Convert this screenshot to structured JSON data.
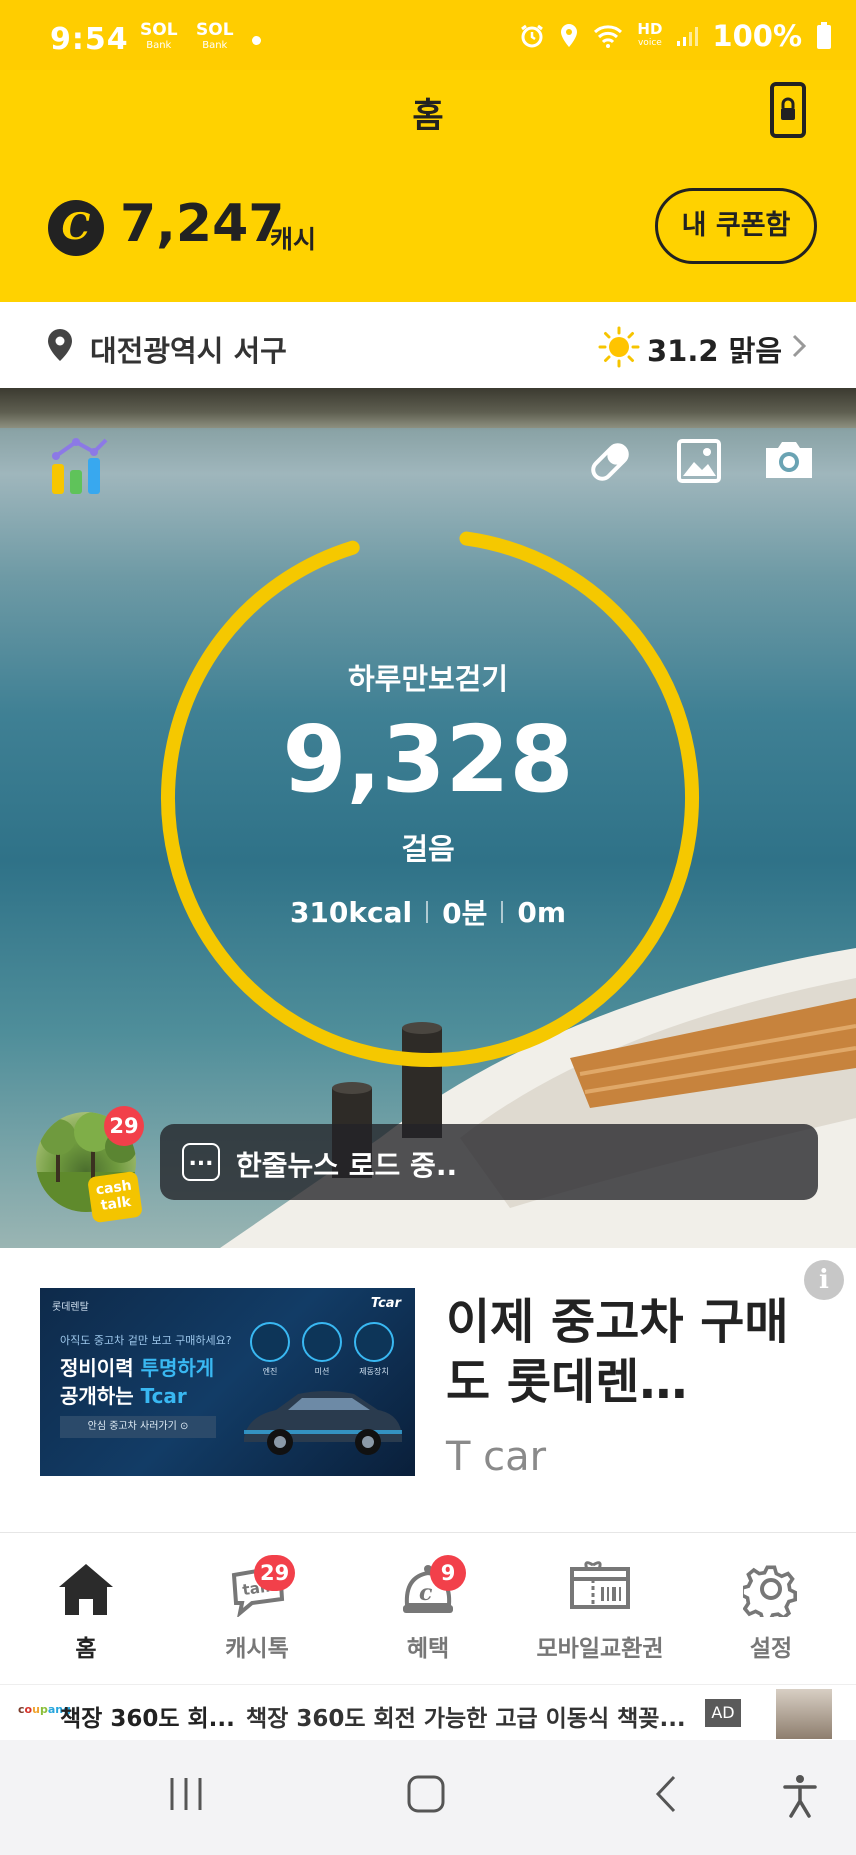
{
  "status_bar": {
    "time": "9:54",
    "bank1": "SOL",
    "bank1_sub": "Bank",
    "bank2": "SOL",
    "bank2_sub": "Bank",
    "hd": "HD",
    "hd_sub": "voice",
    "battery": "100%"
  },
  "header": {
    "title": "홈",
    "cash_amount": "7,247",
    "cash_unit": "캐시",
    "coin_symbol": "C",
    "coupon_button": "내 쿠폰함"
  },
  "location": {
    "city": "대전광역시 서구",
    "weather": "31.2 맑음"
  },
  "walk": {
    "title": "하루만보걷기",
    "steps": "9,328",
    "unit": "걸음",
    "kcal": "310kcal",
    "minutes": "0분",
    "distance": "0m",
    "progress": 0.93
  },
  "cashtalk": {
    "badge_count": "29",
    "label_line1": "cash",
    "label_line2": "talk",
    "news_dots": "...",
    "news_text": "한줄뉴스 로드 중.."
  },
  "ad": {
    "info": "i",
    "banner_brand": "롯데렌탈",
    "banner_logo": "Tcar",
    "banner_question": "아직도 중고차 겉만 보고 구매하세요?",
    "banner_line1_a": "정비이력 ",
    "banner_line1_b": "투명하게",
    "banner_line2_a": "공개하는 ",
    "banner_line2_b": "Tcar",
    "banner_cta": "안심 중고차 사러가기 ⊙",
    "banner_features": [
      "엔진",
      "미션",
      "제동장치"
    ],
    "title": "이제 중고차 구매도 롯데렌…",
    "sub": "T car"
  },
  "bottom_nav": {
    "items": [
      {
        "label": "홈",
        "badge": ""
      },
      {
        "label": "캐시톡",
        "badge": "29"
      },
      {
        "label": "혜택",
        "badge": "9"
      },
      {
        "label": "모바일교환권",
        "badge": ""
      },
      {
        "label": "설정",
        "badge": ""
      }
    ]
  },
  "coupang_ad": {
    "logo": [
      "c",
      "o",
      "u",
      "p",
      "ang"
    ],
    "text1": "책장 360도 회...",
    "text2": "책장 360도 회전 가능한 고급 이동식 책꽂...",
    "ad_label": "AD"
  },
  "colors": {
    "brand_yellow": "#ffd200",
    "ring_yellow": "#f5c800",
    "badge_red": "#f2404a"
  }
}
